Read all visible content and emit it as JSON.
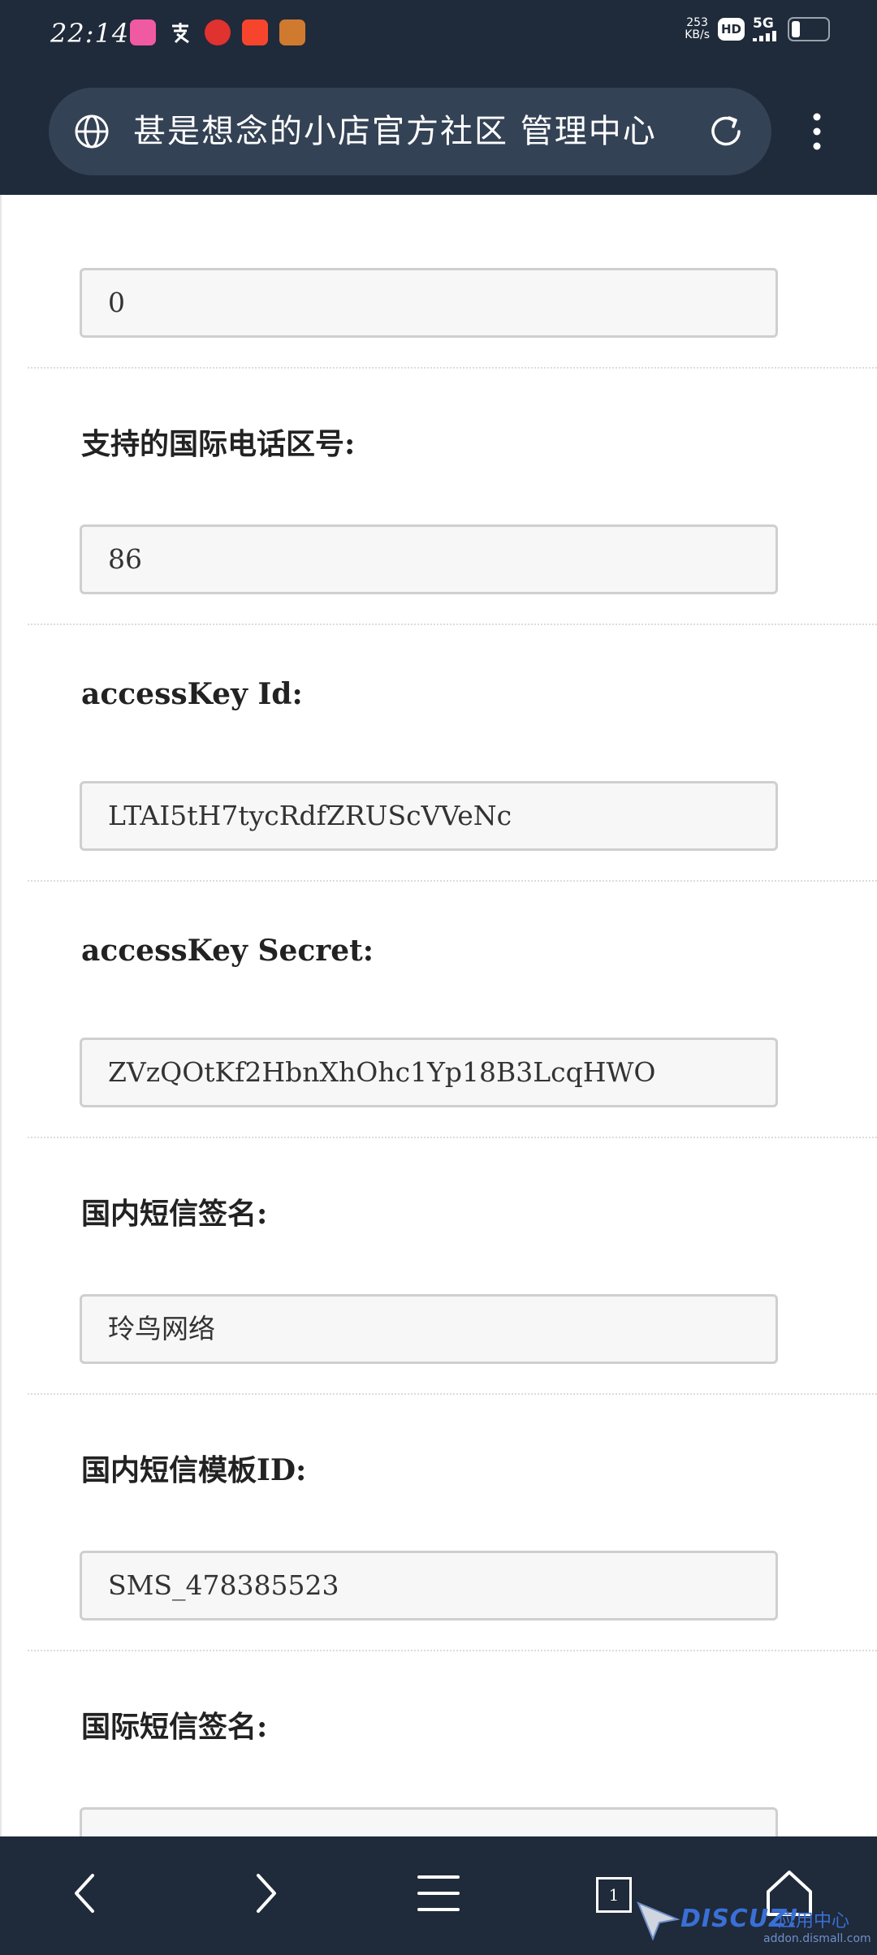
{
  "status_bar": {
    "time": "22:14",
    "net_speed_value": "253",
    "net_speed_unit": "KB/s",
    "hd_label": "HD",
    "network_label": "5G",
    "app_icons": [
      "lala-icon",
      "alipay-icon",
      "bank-icon",
      "pinduoduo-icon",
      "game-icon"
    ]
  },
  "browser": {
    "page_title": "甚是想念的小店官方社区 管理中心",
    "icons": [
      "globe-icon",
      "reload-icon",
      "more-vertical-icon"
    ]
  },
  "form": {
    "fields": [
      {
        "label": "",
        "value": "0"
      },
      {
        "label": "支持的国际电话区号:",
        "value": "86"
      },
      {
        "label": "accessKey Id:",
        "value": "LTAI5tH7tycRdfZRUScVVeNc"
      },
      {
        "label": "accessKey Secret:",
        "value": "ZVzQOtKf2HbnXhOhc1Yp18B3LcqHWO"
      },
      {
        "label": "国内短信签名:",
        "value": "玲鸟网络"
      },
      {
        "label": "国内短信模板ID:",
        "value": "SMS_478385523"
      },
      {
        "label": "国际短信签名:",
        "value": ""
      }
    ]
  },
  "bottom_nav": {
    "tab_count": "1",
    "icons": [
      "back-icon",
      "forward-icon",
      "menu-icon",
      "tabs-icon",
      "home-icon"
    ]
  },
  "watermark": {
    "brand": "DISCUZ!",
    "sub": "应用中心",
    "url": "addon.dismall.com"
  },
  "colors": {
    "header_bg": "#1f2a3a",
    "urlbar_bg": "#344255",
    "input_bg": "#f7f7f7",
    "input_border": "#cfcfcf",
    "watermark": "#3a6fd6"
  }
}
